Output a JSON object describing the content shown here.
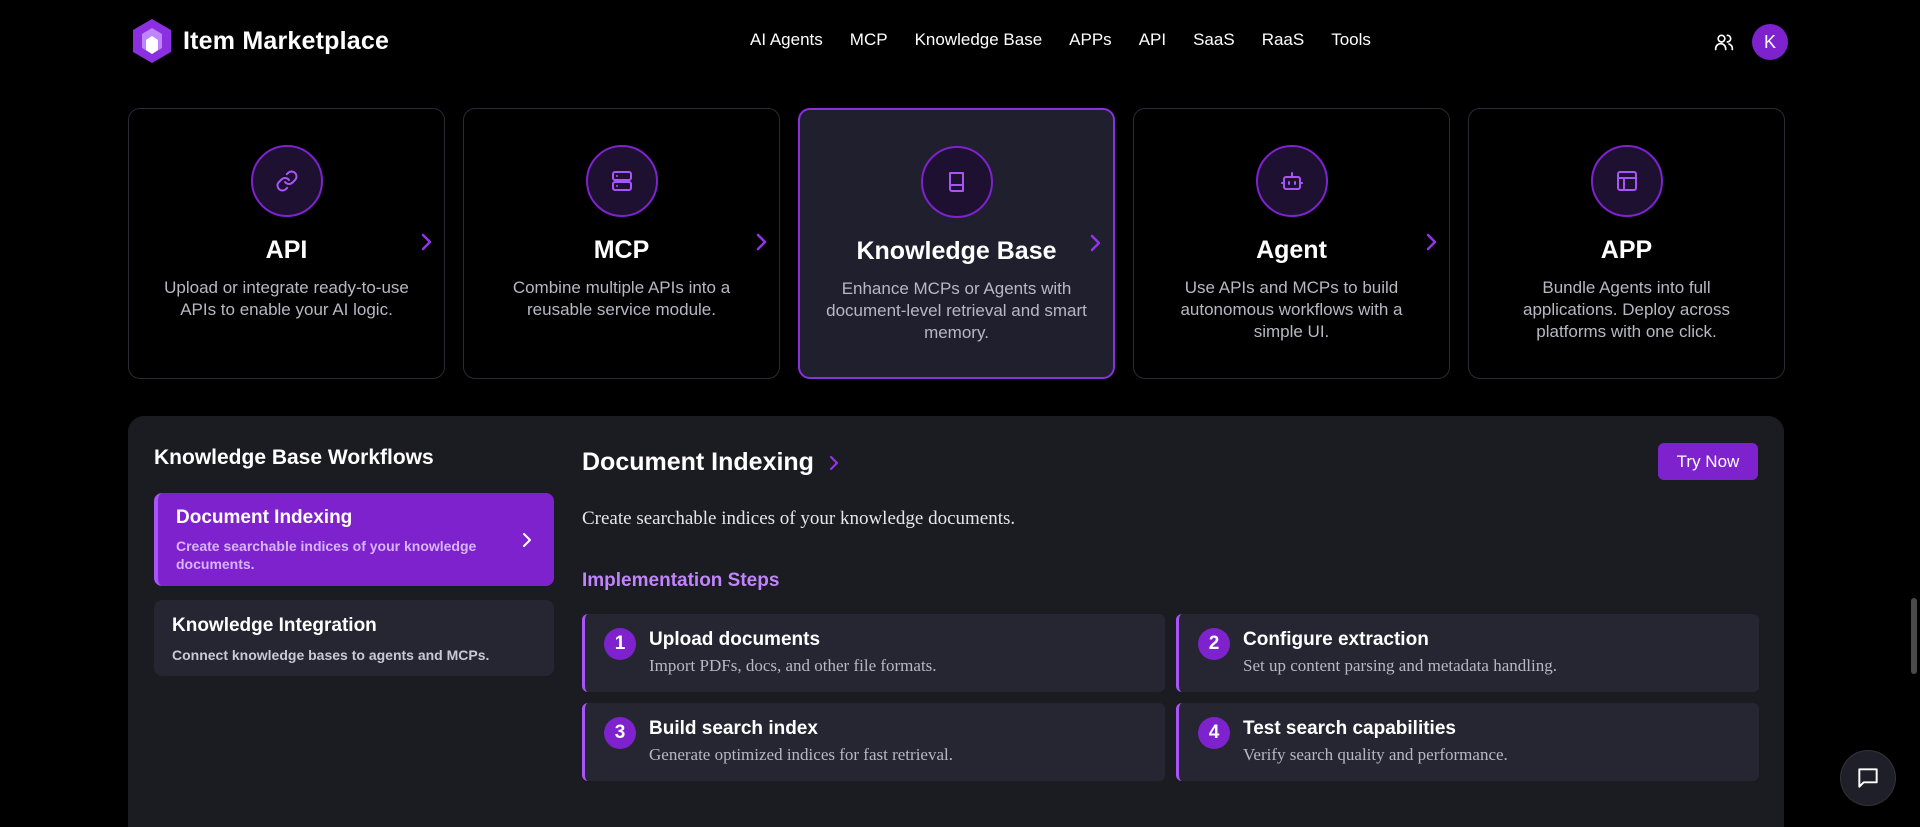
{
  "header": {
    "brand": "Item Marketplace",
    "nav": [
      "AI Agents",
      "MCP",
      "Knowledge Base",
      "APPs",
      "API",
      "SaaS",
      "RaaS",
      "Tools"
    ],
    "avatar_initial": "K"
  },
  "cards": [
    {
      "title": "API",
      "desc": "Upload or integrate ready-to-use APIs to enable your AI logic.",
      "icon": "link-icon",
      "active": false
    },
    {
      "title": "MCP",
      "desc": "Combine multiple APIs into a reusable service module.",
      "icon": "server-icon",
      "active": false
    },
    {
      "title": "Knowledge Base",
      "desc": "Enhance MCPs or Agents with document-level retrieval and smart memory.",
      "icon": "book-icon",
      "active": true
    },
    {
      "title": "Agent",
      "desc": "Use APIs and MCPs to build autonomous workflows with a simple UI.",
      "icon": "bot-icon",
      "active": false
    },
    {
      "title": "APP",
      "desc": "Bundle Agents into full applications. Deploy across platforms with one click.",
      "icon": "layout-icon",
      "active": false
    }
  ],
  "workflows": {
    "title": "Knowledge Base Workflows",
    "items": [
      {
        "name": "Document Indexing",
        "desc": "Create searchable indices of your knowledge documents."
      },
      {
        "name": "Knowledge Integration",
        "desc": "Connect knowledge bases to agents and MCPs."
      }
    ]
  },
  "detail": {
    "title": "Document Indexing",
    "try_label": "Try Now",
    "desc": "Create searchable indices of your knowledge documents.",
    "steps_heading": "Implementation Steps",
    "steps": [
      {
        "num": "1",
        "title": "Upload documents",
        "desc": "Import PDFs, docs, and other file formats."
      },
      {
        "num": "2",
        "title": "Configure extraction",
        "desc": "Set up content parsing and metadata handling."
      },
      {
        "num": "3",
        "title": "Build search index",
        "desc": "Generate optimized indices for fast retrieval."
      },
      {
        "num": "4",
        "title": "Test search capabilities",
        "desc": "Verify search quality and performance."
      }
    ]
  },
  "colors": {
    "accent": "#7e22ce",
    "accent_light": "#a855f7",
    "panel_bg": "#1b1b22",
    "step_bg": "#262633"
  }
}
